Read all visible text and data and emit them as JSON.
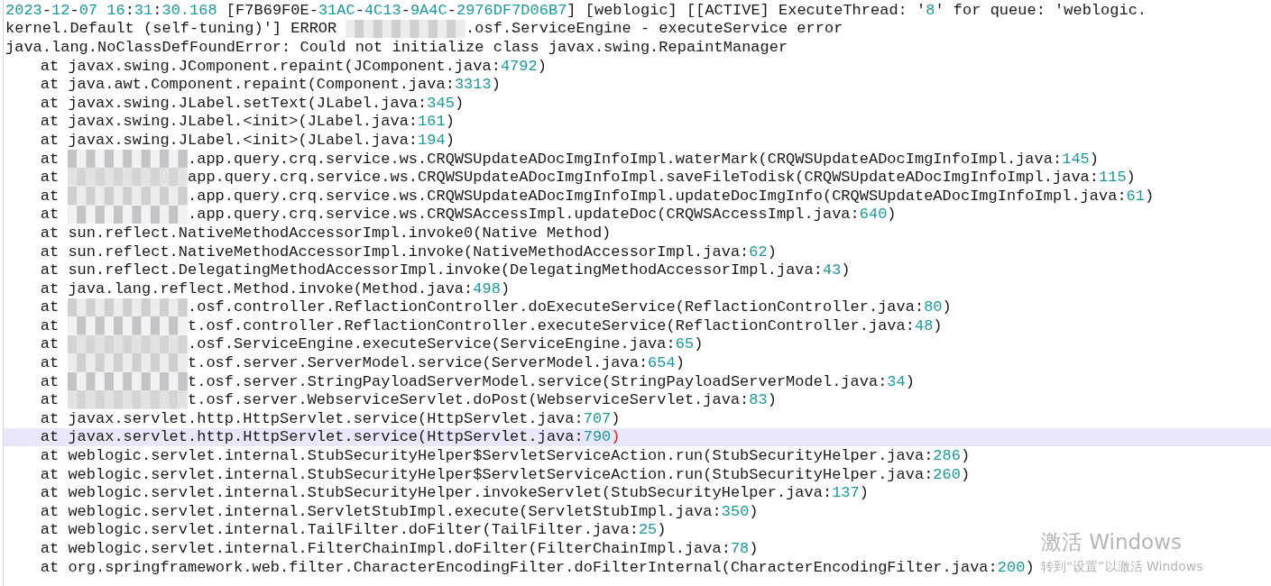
{
  "lines": [
    {
      "kind": "message",
      "text": "2023-12-07 16:31:30.168 [F7B69F0E-31AC-4C13-9A4C-2976DF7D06B7] [weblogic] [[ACTIVE] ExecuteThread: '8' for queue: 'weblogic.",
      "redacted": false,
      "selected": false
    },
    {
      "kind": "message",
      "lead": "kernel.Default (self-tuning)'] ERROR",
      "text": ".osf.ServiceEngine - executeService error",
      "redacted": true,
      "selected": false
    },
    {
      "kind": "message",
      "text": "java.lang.NoClassDefFoundError: Could not initialize class javax.swing.RepaintManager",
      "redacted": false,
      "selected": false
    },
    {
      "kind": "frame",
      "text": "at javax.swing.JComponent.repaint(JComponent.java:4792)",
      "redacted": false,
      "selected": false
    },
    {
      "kind": "frame",
      "text": "at java.awt.Component.repaint(Component.java:3313)",
      "redacted": false,
      "selected": false
    },
    {
      "kind": "frame",
      "text": "at javax.swing.JLabel.setText(JLabel.java:345)",
      "redacted": false,
      "selected": false
    },
    {
      "kind": "frame",
      "text": "at javax.swing.JLabel.<init>(JLabel.java:161)",
      "redacted": false,
      "selected": false
    },
    {
      "kind": "frame",
      "text": "at javax.swing.JLabel.<init>(JLabel.java:194)",
      "redacted": false,
      "selected": false
    },
    {
      "kind": "frame",
      "lead": "at",
      "text": ".app.query.crq.service.ws.CRQWSUpdateADocImgInfoImpl.waterMark(CRQWSUpdateADocImgInfoImpl.java:145)",
      "redacted": true,
      "selected": false
    },
    {
      "kind": "frame",
      "lead": "at",
      "text": "app.query.crq.service.ws.CRQWSUpdateADocImgInfoImpl.saveFileTodisk(CRQWSUpdateADocImgInfoImpl.java:115)",
      "redacted": true,
      "selected": false
    },
    {
      "kind": "frame",
      "lead": "at",
      "text": ".app.query.crq.service.ws.CRQWSUpdateADocImgInfoImpl.updateDocImgInfo(CRQWSUpdateADocImgInfoImpl.java:61)",
      "redacted": true,
      "selected": false
    },
    {
      "kind": "frame",
      "lead": "at",
      "text": ".app.query.crq.service.ws.CRQWSAccessImpl.updateDoc(CRQWSAccessImpl.java:640)",
      "redacted": true,
      "selected": false
    },
    {
      "kind": "frame",
      "text": "at sun.reflect.NativeMethodAccessorImpl.invoke0(Native Method)",
      "redacted": false,
      "selected": false
    },
    {
      "kind": "frame",
      "text": "at sun.reflect.NativeMethodAccessorImpl.invoke(NativeMethodAccessorImpl.java:62)",
      "redacted": false,
      "selected": false
    },
    {
      "kind": "frame",
      "text": "at sun.reflect.DelegatingMethodAccessorImpl.invoke(DelegatingMethodAccessorImpl.java:43)",
      "redacted": false,
      "selected": false
    },
    {
      "kind": "frame",
      "text": "at java.lang.reflect.Method.invoke(Method.java:498)",
      "redacted": false,
      "selected": false
    },
    {
      "kind": "frame",
      "lead": "at",
      "text": ".osf.controller.ReflactionController.doExecuteService(ReflactionController.java:80)",
      "redacted": true,
      "selected": false
    },
    {
      "kind": "frame",
      "lead": "at",
      "text": "t.osf.controller.ReflactionController.executeService(ReflactionController.java:48)",
      "redacted": true,
      "selected": false
    },
    {
      "kind": "frame",
      "lead": "at",
      "text": ".osf.ServiceEngine.executeService(ServiceEngine.java:65)",
      "redacted": true,
      "selected": false
    },
    {
      "kind": "frame",
      "lead": "at",
      "text": "t.osf.server.ServerModel.service(ServerModel.java:654)",
      "redacted": true,
      "selected": false
    },
    {
      "kind": "frame",
      "lead": "at",
      "text": "t.osf.server.StringPayloadServerModel.service(StringPayloadServerModel.java:34)",
      "redacted": true,
      "selected": false
    },
    {
      "kind": "frame",
      "lead": "at",
      "text": "t.osf.server.WebserviceServlet.doPost(WebserviceServlet.java:83)",
      "redacted": true,
      "selected": false
    },
    {
      "kind": "frame",
      "text": "at javax.servlet.http.HttpServlet.service(HttpServlet.java:707)",
      "redacted": false,
      "selected": false
    },
    {
      "kind": "frame",
      "text": "at javax.servlet.http.HttpServlet.service(HttpServlet.java:790)",
      "redacted": false,
      "selected": true
    },
    {
      "kind": "frame",
      "text": "at weblogic.servlet.internal.StubSecurityHelper$ServletServiceAction.run(StubSecurityHelper.java:286)",
      "redacted": false,
      "selected": false
    },
    {
      "kind": "frame",
      "text": "at weblogic.servlet.internal.StubSecurityHelper$ServletServiceAction.run(StubSecurityHelper.java:260)",
      "redacted": false,
      "selected": false
    },
    {
      "kind": "frame",
      "text": "at weblogic.servlet.internal.StubSecurityHelper.invokeServlet(StubSecurityHelper.java:137)",
      "redacted": false,
      "selected": false
    },
    {
      "kind": "frame",
      "text": "at weblogic.servlet.internal.ServletStubImpl.execute(ServletStubImpl.java:350)",
      "redacted": false,
      "selected": false
    },
    {
      "kind": "frame",
      "text": "at weblogic.servlet.internal.TailFilter.doFilter(TailFilter.java:25)",
      "redacted": false,
      "selected": false
    },
    {
      "kind": "frame",
      "text": "at weblogic.servlet.internal.FilterChainImpl.doFilter(FilterChainImpl.java:78)",
      "redacted": false,
      "selected": false
    },
    {
      "kind": "frame",
      "text": "at org.springframework.web.filter.CharacterEncodingFilter.doFilterInternal(CharacterEncodingFilter.java:200)",
      "redacted": false,
      "selected": false
    }
  ],
  "activation_notice": {
    "title": "激活 Windows",
    "text": "转到“设置”以激活 Windows"
  }
}
